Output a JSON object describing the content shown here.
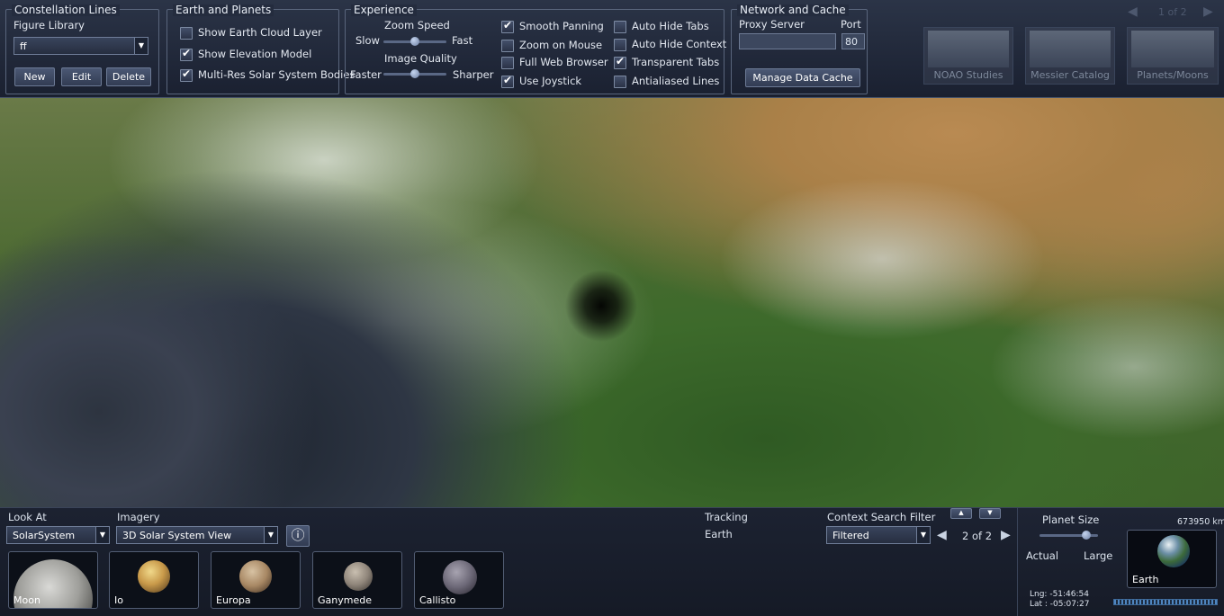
{
  "top": {
    "pager": {
      "prev_icon": "◀",
      "text": "1 of 2",
      "next_icon": "▶"
    },
    "background_thumbs": [
      "NOAO Studies",
      "Messier Catalog",
      "Planets/Moons"
    ],
    "constellation": {
      "title": "Constellation Lines",
      "figure_label": "Figure Library",
      "figure_value": "ff",
      "buttons": [
        "New",
        "Edit",
        "Delete"
      ]
    },
    "earth": {
      "title": "Earth and Planets",
      "options": [
        {
          "label": "Show Earth Cloud Layer",
          "checked": false
        },
        {
          "label": "Show Elevation Model",
          "checked": true
        },
        {
          "label": "Multi-Res Solar System Bodies",
          "checked": true
        }
      ]
    },
    "experience": {
      "title": "Experience",
      "zoom_speed": {
        "label": "Zoom Speed",
        "min": "Slow",
        "max": "Fast",
        "level": 0.5
      },
      "image_quality": {
        "label": "Image Quality",
        "min": "Faster",
        "max": "Sharper",
        "level": 0.5
      },
      "options_col1": [
        {
          "label": "Smooth Panning",
          "checked": true
        },
        {
          "label": "Zoom on Mouse",
          "checked": false
        },
        {
          "label": "Full Web Browser",
          "checked": false
        },
        {
          "label": "Use Joystick",
          "checked": true
        }
      ],
      "options_col2": [
        {
          "label": "Auto Hide Tabs",
          "checked": false
        },
        {
          "label": "Auto Hide Context",
          "checked": false
        },
        {
          "label": "Transparent Tabs",
          "checked": true
        },
        {
          "label": "Antialiased Lines",
          "checked": false
        }
      ]
    },
    "network": {
      "title": "Network and Cache",
      "proxy_label": "Proxy Server",
      "proxy_value": "",
      "port_label": "Port",
      "port_value": "80",
      "cache_button": "Manage Data Cache"
    }
  },
  "bottom": {
    "look_at": {
      "label": "Look At",
      "value": "SolarSystem"
    },
    "imagery": {
      "label": "Imagery",
      "value": "3D Solar System View"
    },
    "info_icon": "ⓘ",
    "moons": [
      "Moon",
      "Io",
      "Europa",
      "Ganymede",
      "Callisto"
    ],
    "tracking": {
      "label": "Tracking",
      "value": "Earth"
    },
    "context_filter": {
      "label": "Context Search Filter",
      "value": "Filtered"
    },
    "pager": {
      "prev_icon": "◀",
      "text": "2 of 2",
      "next_icon": "▶"
    },
    "planet_size": {
      "label": "Planet Size",
      "min": "Actual",
      "max": "Large",
      "level": 0.85
    },
    "distance": "673950 km",
    "thumbnail_label": "Earth",
    "coords": {
      "lng": "Lng:  -51:46:54",
      "lat": "Lat :  -05:07:27"
    }
  },
  "colors": {
    "panel": "#1f2637",
    "border": "#59657c",
    "accent": "#8fb4e8"
  }
}
